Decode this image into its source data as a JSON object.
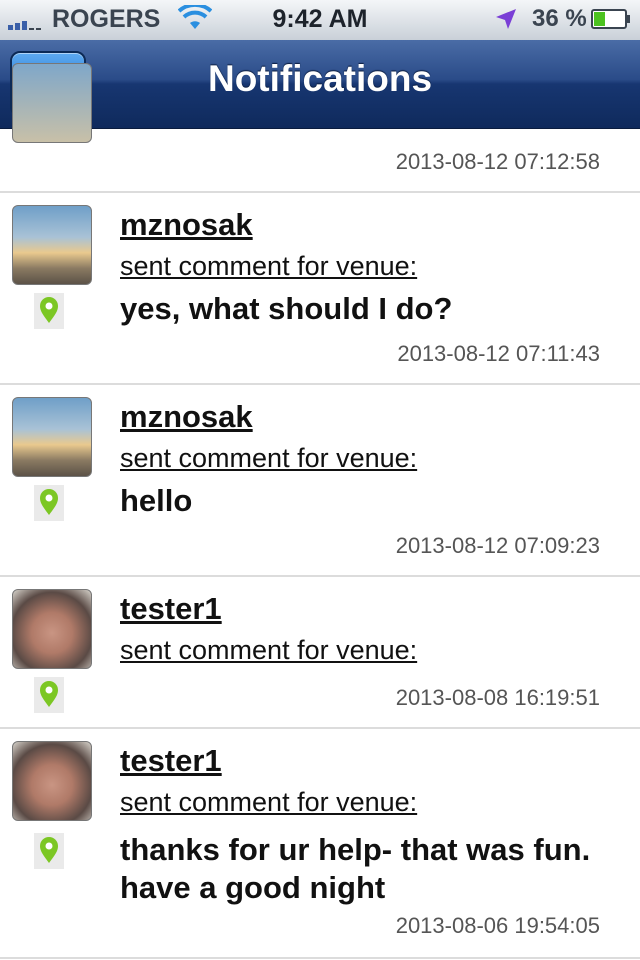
{
  "status_bar": {
    "carrier": "ROGERS",
    "time": "9:42 AM",
    "battery_percent": "36 %",
    "battery_level": 0.36,
    "signal-icon": "signal-bars-icon",
    "wifi-icon": "wifi-icon",
    "location-icon": "location-arrow-icon"
  },
  "nav": {
    "title": "Notifications",
    "home_icon": "home-icon",
    "accent": "#2f83d8"
  },
  "notifications": [
    {
      "username": "",
      "action": "",
      "message": "",
      "timestamp": "2013-08-12 07:12:58"
    },
    {
      "username": "mznosak",
      "action": "sent comment for venue:",
      "message": "yes, what should I do?",
      "timestamp": "2013-08-12 07:11:43"
    },
    {
      "username": "mznosak",
      "action": "sent comment for venue:",
      "message": "hello",
      "timestamp": "2013-08-12 07:09:23"
    },
    {
      "username": "tester1",
      "action": "sent comment for venue:",
      "message": "",
      "timestamp": "2013-08-08 16:19:51"
    },
    {
      "username": "tester1",
      "action": "sent comment for venue:",
      "message": "thanks for ur help- that was fun. have a good night",
      "timestamp": "2013-08-06 19:54:05"
    }
  ]
}
